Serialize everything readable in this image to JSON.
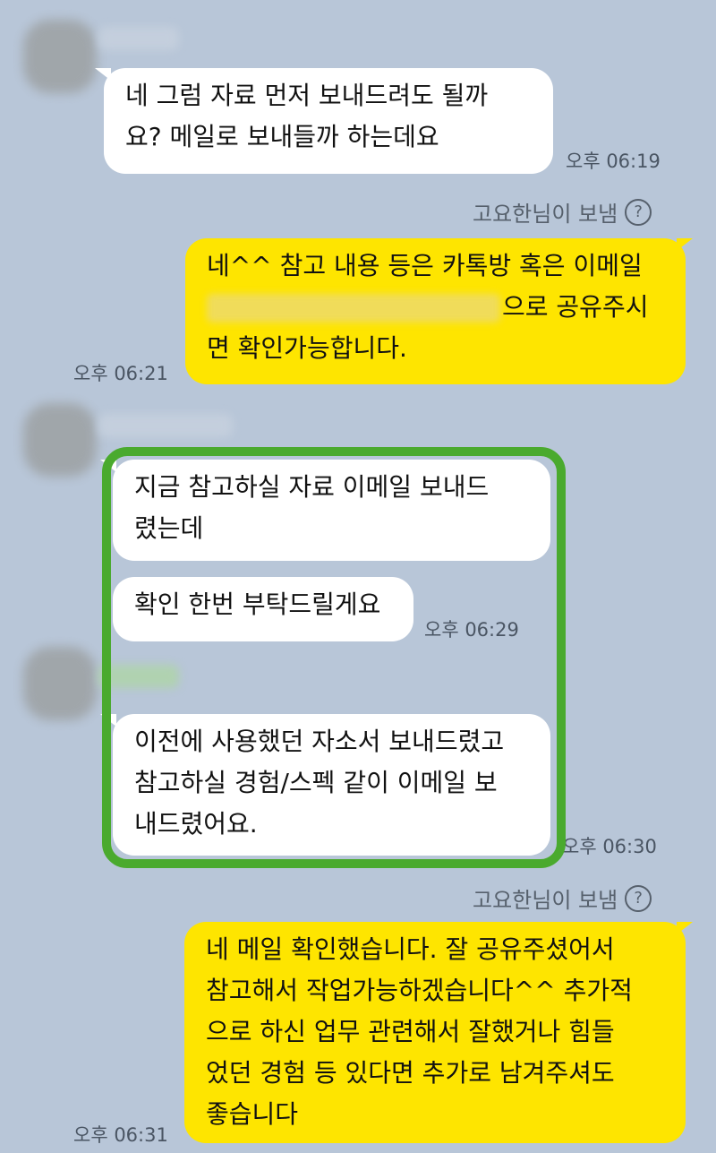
{
  "messages": [
    {
      "id": "m1",
      "lines": [
        "네 그럼 자료 먼저 보내드려도 될까",
        "요? 메일로 보내들까 하는데요"
      ],
      "time": "오후 06:19"
    },
    {
      "id": "m2",
      "sender_label": "고요한님이 보냄",
      "lines_before": "네^^ 참고 내용 등은 카톡방 혹은 이메일",
      "after_redact": "으로 공유주시",
      "last": "면 확인가능합니다.",
      "time": "오후 06:21"
    },
    {
      "id": "m3",
      "lines": [
        "지금 참고하실 자료 이메일 보내드",
        "렸는데"
      ]
    },
    {
      "id": "m4",
      "lines": [
        "확인 한번 부탁드릴게요"
      ],
      "time": "오후 06:29"
    },
    {
      "id": "m5",
      "lines": [
        "이전에 사용했던 자소서 보내드렸고",
        "참고하실 경험/스펙 같이 이메일 보",
        "내드렸어요."
      ],
      "time": "오후 06:30"
    },
    {
      "id": "m6",
      "sender_label": "고요한님이 보냄",
      "lines": [
        "네 메일 확인했습니다. 잘 공유주셨어서",
        "참고해서 작업가능하겠습니다^^ 추가적",
        "으로 하신 업무 관련해서 잘했거나 힘들",
        "었던 경험 등 있다면 추가로 남겨주셔도",
        "좋습니다"
      ],
      "time": "오후 06:31"
    }
  ],
  "icons": {
    "help": "?"
  },
  "colors": {
    "background": "#b8c6d8",
    "mine": "#fee500",
    "theirs": "#ffffff",
    "highlight": "#4aaa2e"
  }
}
